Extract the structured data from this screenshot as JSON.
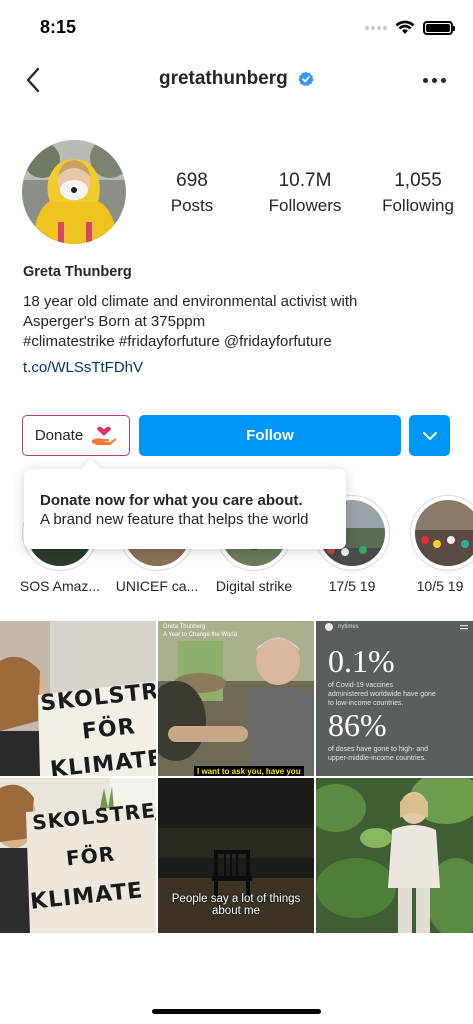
{
  "status_bar": {
    "time": "8:15"
  },
  "header": {
    "username": "gretathunberg",
    "back_icon": "chevron-left-icon",
    "more_icon": "more-horizontal-icon",
    "verified_color": "#3897f0"
  },
  "profile": {
    "stats": [
      {
        "value": "698",
        "label": "Posts"
      },
      {
        "value": "10.7M",
        "label": "Followers"
      },
      {
        "value": "1,055",
        "label": "Following"
      }
    ],
    "name": "Greta Thunberg",
    "bio_line1": "18 year old climate and environmental activist with",
    "bio_line2": "Asperger's Born at 375ppm",
    "bio_line3": "#climatestrike #fridayforfuture @fridayforfuture",
    "link": "t.co/WLSsTtFDhV"
  },
  "actions": {
    "donate_label": "Donate",
    "follow_label": "Follow",
    "accent_color": "#0095f6"
  },
  "tooltip": {
    "title": "Donate now for what you care about.",
    "text": "A brand new feature that helps the world"
  },
  "highlights": [
    {
      "label": "SOS Amaz..."
    },
    {
      "label": "UNICEF ca..."
    },
    {
      "label": "Digital strike"
    },
    {
      "label": "17/5 19"
    },
    {
      "label": "10/5 19"
    }
  ],
  "posts": {
    "p1_sign": [
      "SKOLSTREJK",
      "FÖR",
      "KLIMATET"
    ],
    "p2_header": "Greta Thunberg",
    "p2_header2": "A Year to Change the World",
    "p2_caption": "I want to ask you, have you",
    "p3_header": "nytimes",
    "p3_stat1": "0.1%",
    "p3_text1a": "of Covid-19 vaccines",
    "p3_text1b": "administered worldwide have gone",
    "p3_text1c": "to low-income countries.",
    "p3_stat2": "86%",
    "p3_text2a": "of doses have gone to high- and",
    "p3_text2b": "upper-middle-income countries.",
    "p4_sign": [
      "SKOLSTREJ",
      "FÖR",
      "KLIMATE"
    ],
    "p5_caption": "People say a lot of things about me"
  }
}
